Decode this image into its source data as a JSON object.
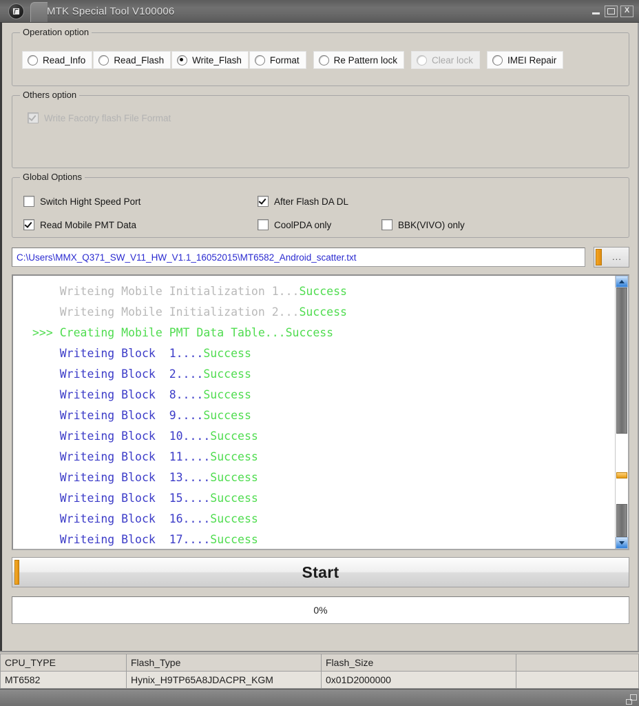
{
  "window": {
    "title": "MTK Special Tool V100006",
    "icon": "app-circle-icon",
    "controls": {
      "minimize": "_",
      "maximize": "□",
      "close": "X"
    }
  },
  "operation_option": {
    "legend": "Operation option",
    "radios": [
      {
        "label": "Read_Info",
        "checked": false,
        "disabled": false
      },
      {
        "label": "Read_Flash",
        "checked": false,
        "disabled": false
      },
      {
        "label": "Write_Flash",
        "checked": true,
        "disabled": false
      },
      {
        "label": "Format",
        "checked": false,
        "disabled": false
      },
      {
        "label": "Re Pattern lock",
        "checked": false,
        "disabled": false
      },
      {
        "label": "Clear lock",
        "checked": false,
        "disabled": true
      },
      {
        "label": "IMEI Repair",
        "checked": false,
        "disabled": false
      }
    ]
  },
  "others_option": {
    "legend": "Others option",
    "checkboxes": [
      {
        "label": "Write Facotry flash File Format",
        "checked": true,
        "disabled": true
      }
    ]
  },
  "global_options": {
    "legend": "Global Options",
    "checkboxes": [
      {
        "label": "Switch Hight Speed Port",
        "checked": false,
        "disabled": false
      },
      {
        "label": "After Flash DA DL",
        "checked": true,
        "disabled": false
      },
      {
        "label": "Read Mobile PMT Data",
        "checked": true,
        "disabled": false
      },
      {
        "label": "CoolPDA only",
        "checked": false,
        "disabled": false
      },
      {
        "label": "BBK(VIVO) only",
        "checked": false,
        "disabled": false
      }
    ]
  },
  "scatter_path": {
    "value": "C:\\Users\\MMX_Q371_SW_V11_HW_V1.1_16052015\\MT6582_Android_scatter.txt",
    "placeholder": "Scatter file path",
    "browse_label": "...",
    "text_color": "#2a2ad0"
  },
  "log": {
    "lines": [
      {
        "prefix": "    ",
        "text": "Writeing Mobile Initialization 1...",
        "status": "Success",
        "color": "gray",
        "status_color": "green"
      },
      {
        "prefix": "    ",
        "text": "Writeing Mobile Initialization 2...",
        "status": "Success",
        "color": "gray",
        "status_color": "green"
      },
      {
        "prefix": ">>> ",
        "text": "Creating Mobile PMT Data Table...",
        "status": "Success",
        "color": "green",
        "status_color": "green"
      },
      {
        "prefix": "    ",
        "text": "Writeing Block  1....",
        "status": "Success",
        "color": "blue",
        "status_color": "green"
      },
      {
        "prefix": "    ",
        "text": "Writeing Block  2....",
        "status": "Success",
        "color": "blue",
        "status_color": "green"
      },
      {
        "prefix": "    ",
        "text": "Writeing Block  8....",
        "status": "Success",
        "color": "blue",
        "status_color": "green"
      },
      {
        "prefix": "    ",
        "text": "Writeing Block  9....",
        "status": "Success",
        "color": "blue",
        "status_color": "green"
      },
      {
        "prefix": "    ",
        "text": "Writeing Block  10....",
        "status": "Success",
        "color": "blue",
        "status_color": "green"
      },
      {
        "prefix": "    ",
        "text": "Writeing Block  11....",
        "status": "Success",
        "color": "blue",
        "status_color": "green"
      },
      {
        "prefix": "    ",
        "text": "Writeing Block  13....",
        "status": "Success",
        "color": "blue",
        "status_color": "green"
      },
      {
        "prefix": "    ",
        "text": "Writeing Block  15....",
        "status": "Success",
        "color": "blue",
        "status_color": "green"
      },
      {
        "prefix": "    ",
        "text": "Writeing Block  16....",
        "status": "Success",
        "color": "blue",
        "status_color": "green"
      },
      {
        "prefix": "    ",
        "text": "Writeing Block  17....",
        "status": "Success",
        "color": "blue",
        "status_color": "green"
      }
    ],
    "colors": {
      "gray": "#b9b9b9",
      "green": "#4fdc4f",
      "blue": "#3c3cc8"
    }
  },
  "start_button": {
    "label": "Start"
  },
  "progress": {
    "label": "0%",
    "value": 0
  },
  "info_table": {
    "headers": [
      "CPU_TYPE",
      "Flash_Type",
      "Flash_Size",
      ""
    ],
    "rows": [
      [
        "MT6582",
        "Hynix_H9TP65A8JDACPR_KGM",
        "0x01D2000000",
        ""
      ]
    ]
  }
}
